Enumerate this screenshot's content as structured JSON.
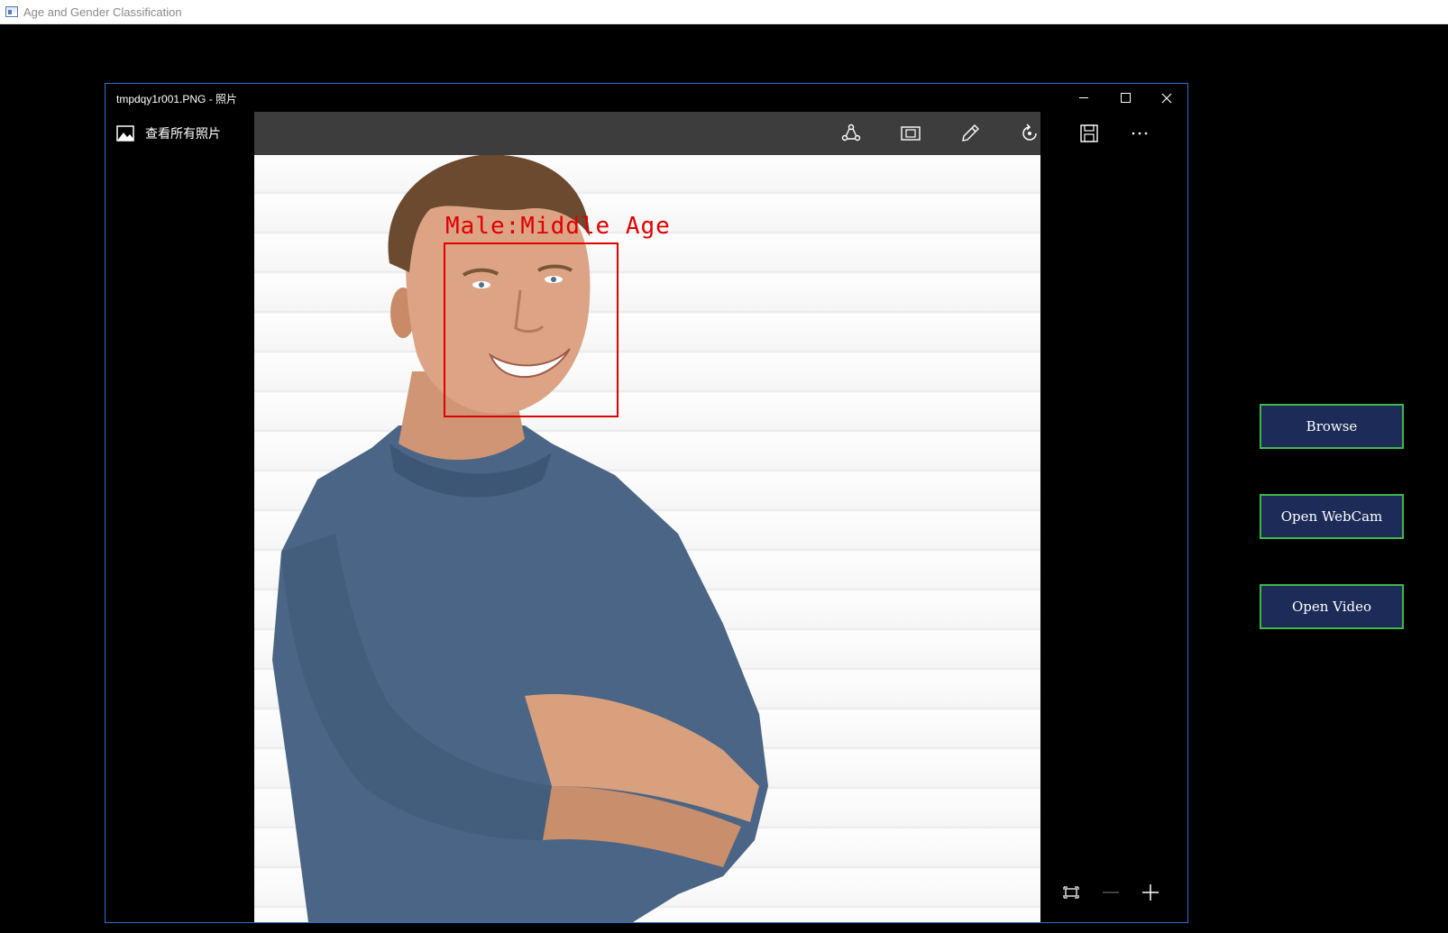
{
  "app": {
    "title": "Age and Gender Classification"
  },
  "photo_viewer": {
    "window_title": "tmpdqy1r001.PNG - 照片",
    "view_all_label": "查看所有照片",
    "toolbar_icons": [
      "share-icon",
      "slideshow-icon",
      "edit-icon",
      "rotate-icon",
      "save-icon",
      "more-icon"
    ],
    "detection": {
      "label": "Male:Middle Age",
      "color": "#e00000"
    },
    "zoom_icons": [
      "fit-screen-icon",
      "zoom-out-icon",
      "zoom-in-icon"
    ]
  },
  "actions": {
    "browse": "Browse",
    "open_webcam": "Open WebCam",
    "open_video": "Open Video"
  },
  "colors": {
    "accent_border": "#3fb84a",
    "button_bg": "#1c2b57",
    "window_border": "#2d6fcd"
  }
}
